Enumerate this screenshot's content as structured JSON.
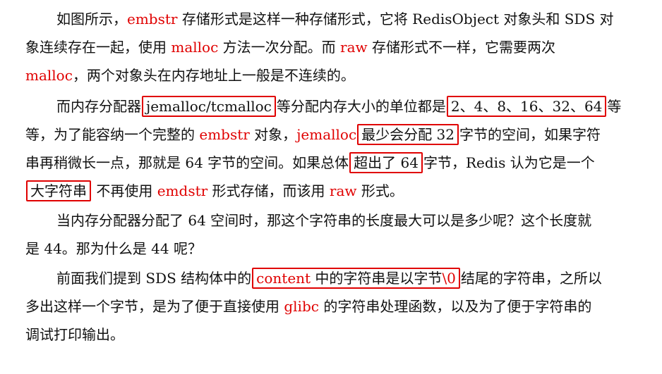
{
  "document": {
    "paragraphs": [
      {
        "lines": [
          [
            {
              "text": "如图所示，"
            },
            {
              "text": "embstr",
              "red": true
            },
            {
              "text": " 存储形式是这样一种存储形式，它将 RedisObject 对象头和 SDS 对"
            }
          ],
          [
            {
              "text": "象连续存在一起，使用 "
            },
            {
              "text": "malloc",
              "red": true
            },
            {
              "text": " 方法一次分配。而 "
            },
            {
              "text": "raw",
              "red": true
            },
            {
              "text": " 存储形式不一样，它需要两次"
            }
          ],
          [
            {
              "text": "malloc",
              "red": true
            },
            {
              "text": "，两个对象头在内存地址上一般是不连续的。"
            }
          ]
        ]
      },
      {
        "lines": [
          [
            {
              "text": "而内存分配器"
            },
            {
              "text": "jemalloc/tcmalloc",
              "boxed": true
            },
            {
              "text": "等分配内存大小的单位都是"
            },
            {
              "text": "2、4、8、16、32、64",
              "boxed": true
            },
            {
              "text": "等"
            }
          ],
          [
            {
              "text": "等，为了能容纳一个完整的 "
            },
            {
              "text": "embstr",
              "red": true
            },
            {
              "text": " 对象，"
            },
            {
              "text": "jemalloc",
              "red": true
            },
            {
              "text": "最少会分配 32",
              "boxed": true
            },
            {
              "text": "字节的空间，如果字符"
            }
          ],
          [
            {
              "text": "串再稍微长一点，那就是 64 字节的空间。如果总体"
            },
            {
              "text": "超出了 64",
              "boxed": true
            },
            {
              "text": "字节，Redis 认为它是一个"
            }
          ],
          [
            {
              "text": "大字符串",
              "boxed": true
            },
            {
              "text": " 不再使用 "
            },
            {
              "text": "emdstr",
              "red": true
            },
            {
              "text": " 形式存储，而该用 "
            },
            {
              "text": "raw",
              "red": true
            },
            {
              "text": " 形式。"
            }
          ]
        ]
      },
      {
        "lines": [
          [
            {
              "text": "当内存分配器分配了 64 空间时，那这个字符串的长度最大可以是多少呢？这个长度就"
            }
          ],
          [
            {
              "text": "是 44。那为什么是 44 呢？"
            }
          ]
        ]
      },
      {
        "lines": [
          [
            {
              "text": "前面我们提到 SDS 结构体中的"
            },
            {
              "text": "content",
              "boxed": true,
              "red": true,
              "box_tail": " 中的字符串是以字节",
              "box_tail2": "\\0"
            },
            {
              "text": "结尾的字符串，之所以"
            }
          ],
          [
            {
              "text": "多出这样一个字节，是为了便于直接使用 "
            },
            {
              "text": "glibc",
              "red": true
            },
            {
              "text": " 的字符串处理函数，以及为了便于字符串的"
            }
          ],
          [
            {
              "text": "调试打印输出。"
            }
          ]
        ]
      }
    ]
  },
  "colors": {
    "text": "#111111",
    "highlight_red": "#e00000",
    "box_border": "#e00000",
    "background": "#ffffff"
  }
}
